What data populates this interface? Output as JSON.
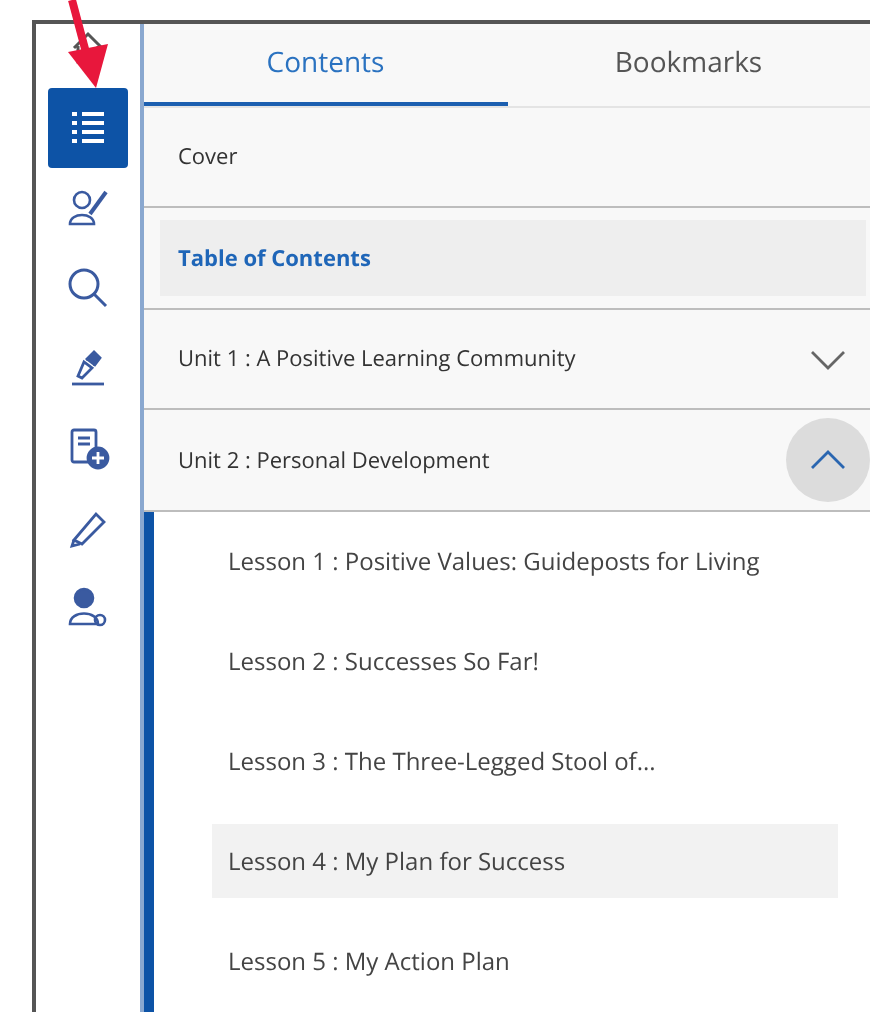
{
  "toolbar": [
    {
      "kind": "home",
      "selected": false
    },
    {
      "kind": "list",
      "selected": true
    },
    {
      "kind": "person-pen",
      "selected": false
    },
    {
      "kind": "search",
      "selected": false
    },
    {
      "kind": "pen",
      "selected": false
    },
    {
      "kind": "note-add",
      "selected": false
    },
    {
      "kind": "highlighter",
      "selected": false
    },
    {
      "kind": "person-gear",
      "selected": false
    }
  ],
  "tabs": [
    {
      "label": "Contents",
      "selected": true
    },
    {
      "label": "Bookmarks",
      "selected": false
    }
  ],
  "toc": [
    {
      "label": "Cover",
      "selected": false
    },
    {
      "label": "Table of Contents",
      "selected": true
    },
    {
      "label": "Unit 1 : A Positive Learning Community",
      "selected": false,
      "expanded": false
    },
    {
      "label": "Unit 2 : Personal Development",
      "selected": false,
      "expanded": true,
      "children": [
        {
          "label": "Lesson 1 : Positive Values: Guideposts for Living",
          "highlighted": false
        },
        {
          "label": "Lesson 2 : Successes So Far!",
          "highlighted": false
        },
        {
          "label": "Lesson 3 : The Three-Legged Stool of...",
          "highlighted": false
        },
        {
          "label": "Lesson 4 : My Plan for Success",
          "highlighted": true
        },
        {
          "label": "Lesson 5 : My Action Plan",
          "highlighted": false
        }
      ]
    }
  ]
}
